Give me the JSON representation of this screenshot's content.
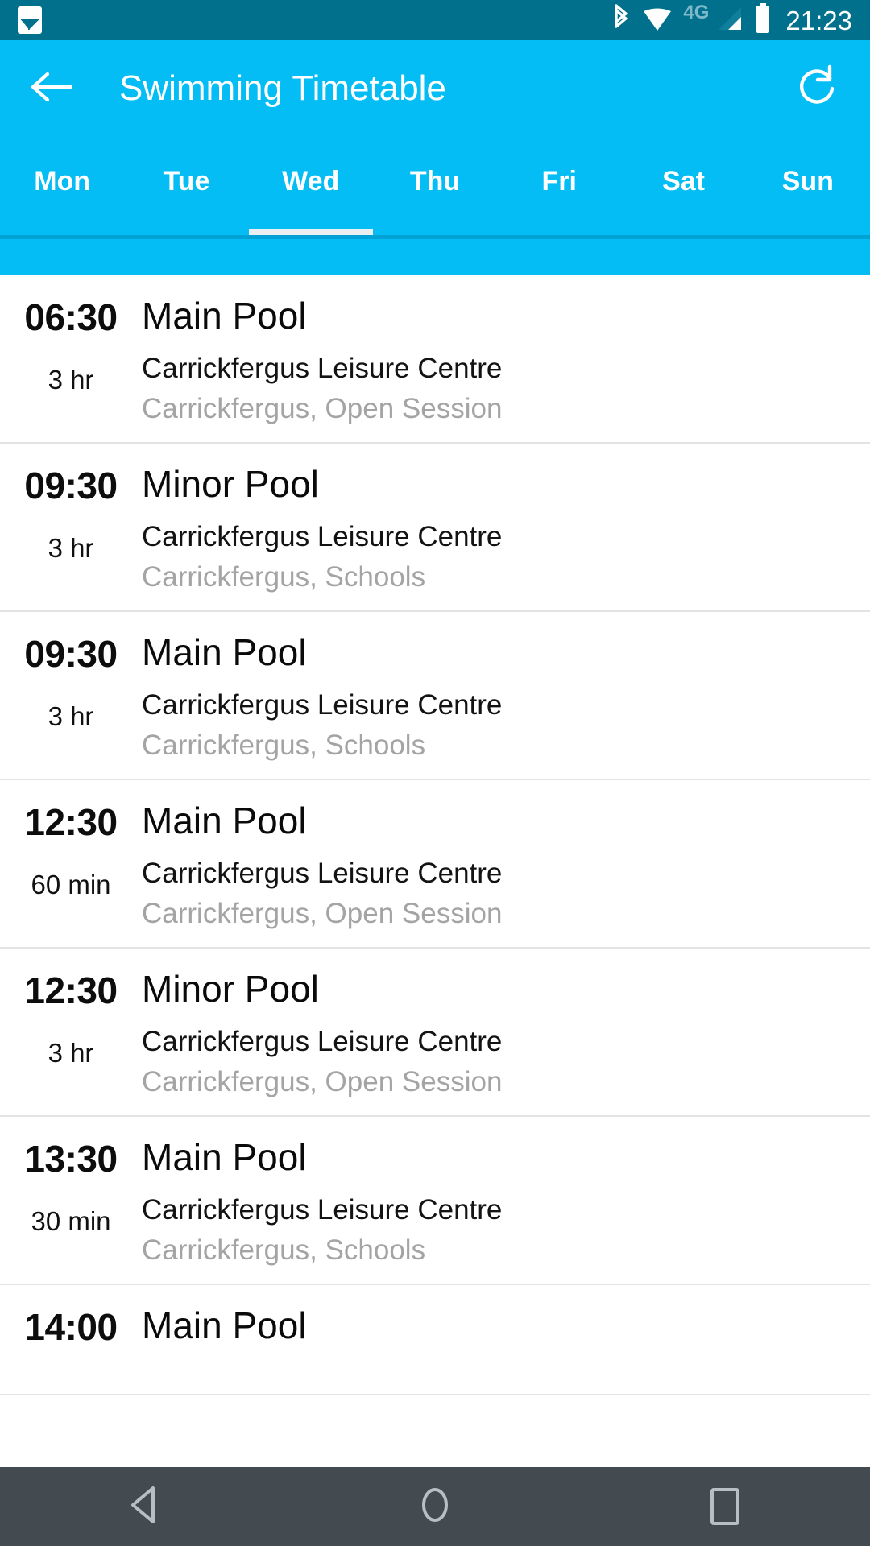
{
  "status_bar": {
    "background": "#00708c",
    "left_icons": [
      {
        "name": "photo-icon",
        "label": "Photo"
      }
    ],
    "right_icons": [
      {
        "name": "bluetooth-icon",
        "label": "Bluetooth"
      },
      {
        "name": "wifi-icon",
        "label": "Wi-Fi"
      },
      {
        "name": "signal-icon",
        "label": "Mobile signal"
      },
      {
        "name": "battery-icon",
        "label": "Battery"
      }
    ],
    "network_label": "4G",
    "clock": "21:23"
  },
  "app_bar": {
    "background": "#03bdf4",
    "back_icon": "back-arrow-icon",
    "title": "Swimming Timetable",
    "refresh_icon": "refresh-icon"
  },
  "tabs": {
    "active_index": 2,
    "items": [
      {
        "label": "Mon"
      },
      {
        "label": "Tue"
      },
      {
        "label": "Wed"
      },
      {
        "label": "Thu"
      },
      {
        "label": "Fri"
      },
      {
        "label": "Sat"
      },
      {
        "label": "Sun"
      }
    ],
    "indicator_color": "#eceff1",
    "divider_color": "#00a2d6"
  },
  "sessions": [
    {
      "time": "06:30",
      "duration": "3 hr",
      "title": "Main Pool",
      "venue": "Carrickfergus Leisure Centre",
      "meta": "Carrickfergus, Open Session"
    },
    {
      "time": "09:30",
      "duration": "3 hr",
      "title": "Minor Pool",
      "venue": "Carrickfergus Leisure Centre",
      "meta": "Carrickfergus, Schools"
    },
    {
      "time": "09:30",
      "duration": "3 hr",
      "title": "Main Pool",
      "venue": "Carrickfergus Leisure Centre",
      "meta": "Carrickfergus, Schools"
    },
    {
      "time": "12:30",
      "duration": "60 min",
      "title": "Main Pool",
      "venue": "Carrickfergus Leisure Centre",
      "meta": "Carrickfergus, Open Session"
    },
    {
      "time": "12:30",
      "duration": "3 hr",
      "title": "Minor Pool",
      "venue": "Carrickfergus Leisure Centre",
      "meta": "Carrickfergus, Open Session"
    },
    {
      "time": "13:30",
      "duration": "30 min",
      "title": "Main Pool",
      "venue": "Carrickfergus Leisure Centre",
      "meta": "Carrickfergus, Schools"
    },
    {
      "time": "14:00",
      "duration": "",
      "title": "Main Pool",
      "venue": "",
      "meta": ""
    }
  ],
  "nav_bar": {
    "background": "#434b51",
    "buttons": [
      {
        "name": "nav-back-button",
        "icon": "triangle-back-icon"
      },
      {
        "name": "nav-home-button",
        "icon": "circle-home-icon"
      },
      {
        "name": "nav-recents-button",
        "icon": "square-recents-icon"
      }
    ]
  }
}
